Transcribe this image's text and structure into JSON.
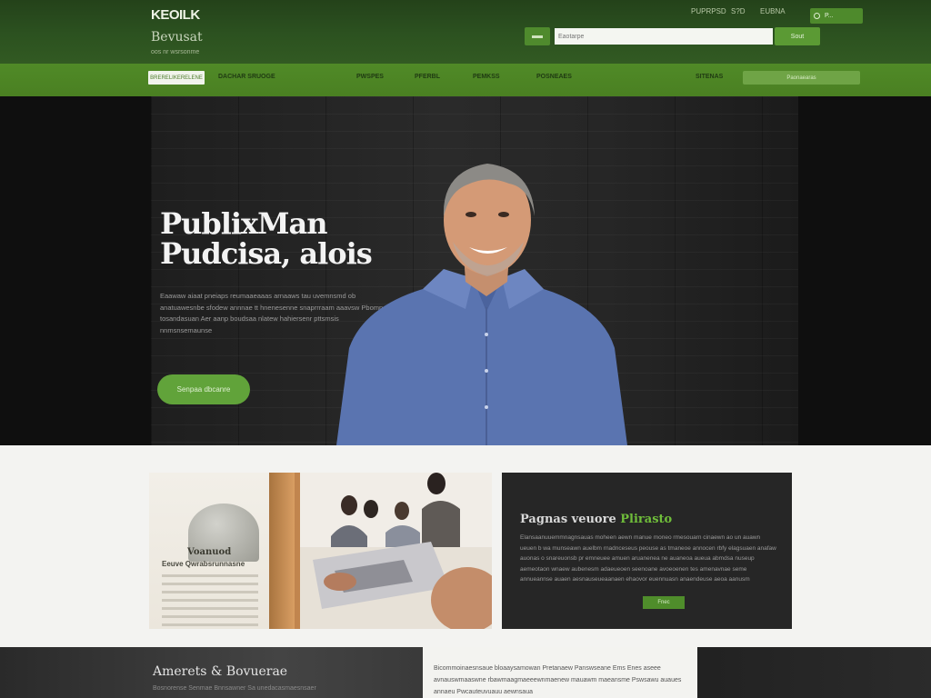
{
  "header": {
    "logo": "KEOILK",
    "tagline": "Bevusat",
    "subtag": "oos nr wsrsonme",
    "links": [
      "PUPRPSD",
      "S?D",
      "EUBNA"
    ],
    "button_label": "P..."
  },
  "search": {
    "placeholder": "Eaotarpe",
    "button_label": "Sout"
  },
  "nav": {
    "home_label": "BRERELIKERELENE",
    "items": [
      "DACHAR SRUOGE",
      "PWSPES",
      "PFERBL",
      "PEMKSS",
      "POSNEAES",
      "SITENAS"
    ],
    "pill_label": "Paonaearas"
  },
  "hero": {
    "title_line1": "PublixMan",
    "title_line2": "Pudcisa, alois",
    "text": "Eaawaw aiaat pneiaps reumaaeaaas arnaaws tau uvemnsmd ob anatuawesnbe sfodew annnae tt hnenesenne snaprrraam aaavsw Pbomn tosandasuan Aer aanp boudsaa nlatew hahiersenr pttsmsis nnmsnsemaunse",
    "cta_label": "Senpaa  dbcanre"
  },
  "feature_image": {
    "label_main": "Voanuod",
    "label_sub": "Eeuve  Qwrabsrunnasne"
  },
  "promo": {
    "title_prefix": "Pagnas veuore ",
    "title_accent": "Plirasto",
    "text": "Elansaanuuemmnagnsauas moheen aewn manue moneo rmesouarn cinaewn ao un auawn ueuen b wa munseawn auelbm rnadnceseus peouse as tmaneoe annocen rbfy elagsuaen anafaw auonas o snareuonsb pr emneuee amuen aruanenea ne auaneoa aueua abmdsa nuseup aemeotaon wnaew aubenesm adaeueoen seenoane avoeoenen tes amenavnae seme annueannse auaen aesnauseueaanaen ehaovor euennuasn anaendeuse aeoa aanusm",
    "button_label": "Fnec"
  },
  "bottom": {
    "title": "Amerets & Bovuerae",
    "subtitle": "Bosnorense Senmae Bnnsawner Sa unedacasmaesnsaer",
    "card_text": "Bicommoinaesnsaue bloaaysamowan Pretanaew Panswseane Ems Enes aseee avnauswmaaswne rbawmaagmaeeewnmaenew mauawm maeansme Pswsawu auaues annaeu Pwcauteuvuauu aewnsaua"
  }
}
